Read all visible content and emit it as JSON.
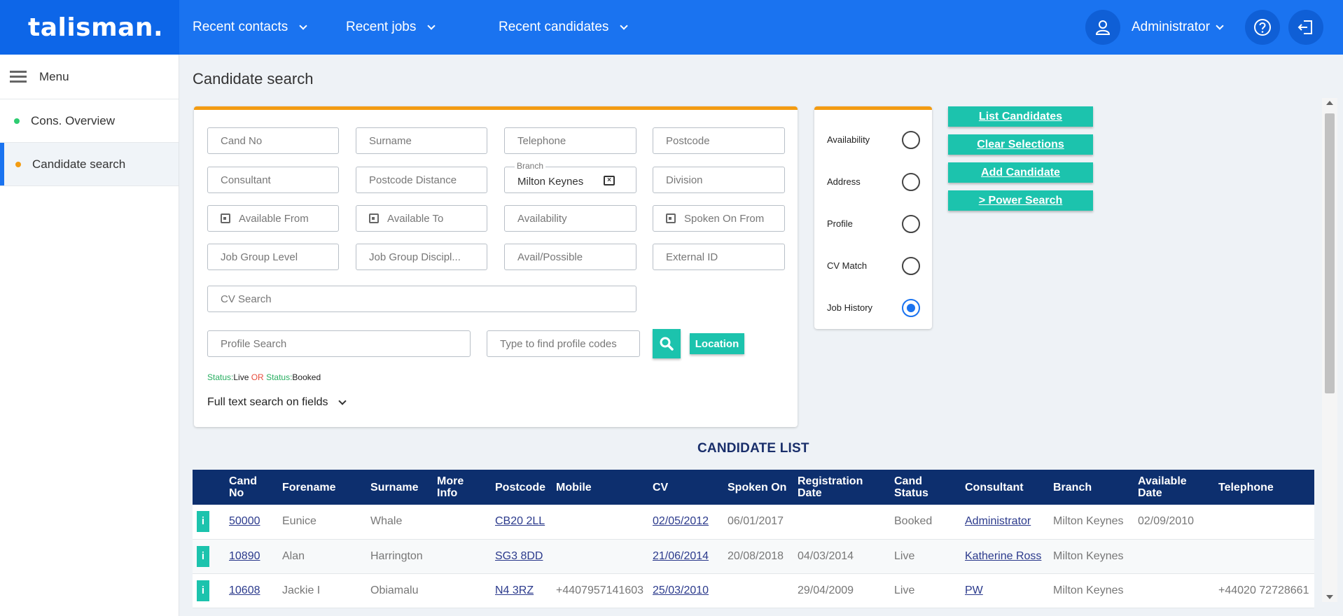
{
  "app": {
    "logo": "talisman."
  },
  "topnav": {
    "recent_contacts": "Recent contacts",
    "recent_jobs": "Recent jobs",
    "recent_candidates": "Recent candidates",
    "user": "Administrator"
  },
  "sidebar": {
    "menu": "Menu",
    "items": [
      {
        "label": "Cons. Overview",
        "dot_color": "#2ecc71"
      },
      {
        "label": "Candidate search",
        "dot_color": "#f39c12"
      }
    ]
  },
  "page": {
    "title": "Candidate search"
  },
  "search": {
    "cand_no": "Cand No",
    "surname": "Surname",
    "telephone": "Telephone",
    "postcode": "Postcode",
    "consultant": "Consultant",
    "postcode_distance": "Postcode Distance",
    "branch_label": "Branch",
    "branch_value": "Milton Keynes",
    "division": "Division",
    "available_from": "Available From",
    "available_to": "Available To",
    "availability": "Availability",
    "spoken_on_from": "Spoken On From",
    "job_group_level": "Job Group Level",
    "job_group_discipline": "Job Group Discipl...",
    "avail_possible": "Avail/Possible",
    "external_id": "External ID",
    "cv_search": "CV Search",
    "profile_search": "Profile Search",
    "profile_codes": "Type to find profile codes",
    "location": "Location",
    "status_part1": "Status:",
    "status_val1": "Live",
    "status_or": "OR",
    "status_part2": "Status:",
    "status_val2": "Booked",
    "full_text": "Full text search on fields"
  },
  "options": {
    "items": [
      {
        "label": "Availability",
        "selected": false
      },
      {
        "label": "Address",
        "selected": false
      },
      {
        "label": "Profile",
        "selected": false
      },
      {
        "label": "CV Match",
        "selected": false
      },
      {
        "label": "Job History",
        "selected": true
      }
    ]
  },
  "actions": {
    "list_candidates": "List Candidates",
    "clear_selections": "Clear Selections",
    "add_candidate": "Add Candidate",
    "power_search": "> Power Search"
  },
  "list": {
    "title": "CANDIDATE LIST",
    "columns": [
      "",
      "Cand No",
      "Forename",
      "Surname",
      "More Info",
      "Postcode",
      "Mobile",
      "CV",
      "Spoken On",
      "Registration Date",
      "Cand Status",
      "Consultant",
      "Branch",
      "Available Date",
      "Telephone"
    ],
    "rows": [
      {
        "info": "i",
        "cand_no": "50000",
        "forename": "Eunice",
        "surname": "Whale",
        "more_info": "",
        "postcode": "CB20 2LL",
        "mobile": "",
        "cv": "02/05/2012",
        "spoken_on": "06/01/2017",
        "reg_date": "",
        "status": "Booked",
        "consultant": "Administrator",
        "branch": "Milton Keynes",
        "available": "02/09/2010",
        "telephone": ""
      },
      {
        "info": "i",
        "cand_no": "10890",
        "forename": "Alan",
        "surname": "Harrington",
        "more_info": "",
        "postcode": "SG3 8DD",
        "mobile": "",
        "cv": "21/06/2014",
        "spoken_on": "20/08/2018",
        "reg_date": "04/03/2014",
        "status": "Live",
        "consultant": "Katherine Ross",
        "branch": "Milton Keynes",
        "available": "",
        "telephone": ""
      },
      {
        "info": "i",
        "cand_no": "10608",
        "forename": "Jackie I",
        "surname": "Obiamalu",
        "more_info": "",
        "postcode": "N4 3RZ",
        "mobile": "+4407957141603",
        "cv": "25/03/2010",
        "spoken_on": "",
        "reg_date": "29/04/2009",
        "status": "Live",
        "consultant": "PW",
        "branch": "Milton Keynes",
        "available": "",
        "telephone": "+44020 72728661"
      }
    ]
  }
}
